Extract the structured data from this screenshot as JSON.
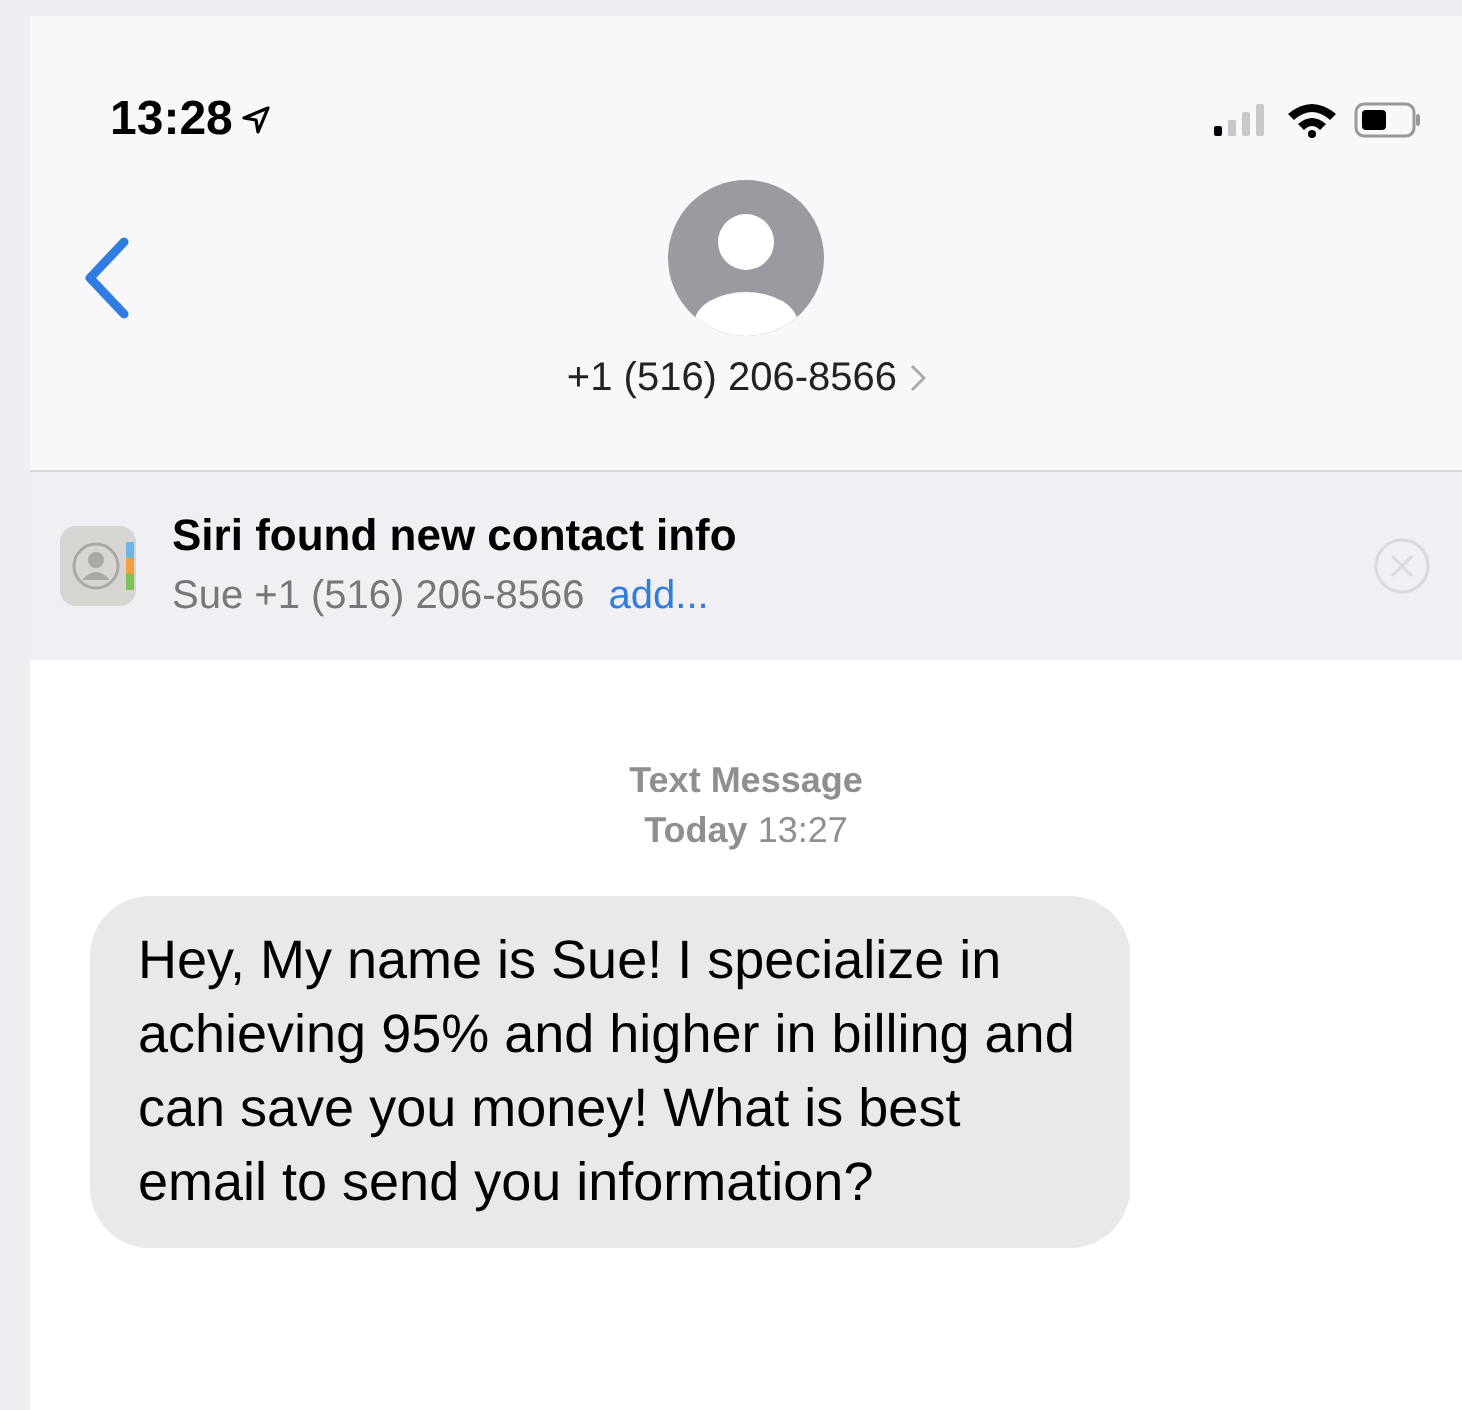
{
  "status_bar": {
    "time": "13:28"
  },
  "header": {
    "contact": "+1 (516) 206-8566"
  },
  "banner": {
    "title": "Siri found new contact info",
    "detail": "Sue +1 (516) 206-8566",
    "action": "add..."
  },
  "thread": {
    "service": "Text Message",
    "timestamp": "**Today** 13:27"
  },
  "messages": [
    {
      "text": "Hey, My name is Sue! I specialize in achieving 95% and higher in billing and can save you money! What is best email to send you information?",
      "kind": "incoming"
    }
  ]
}
